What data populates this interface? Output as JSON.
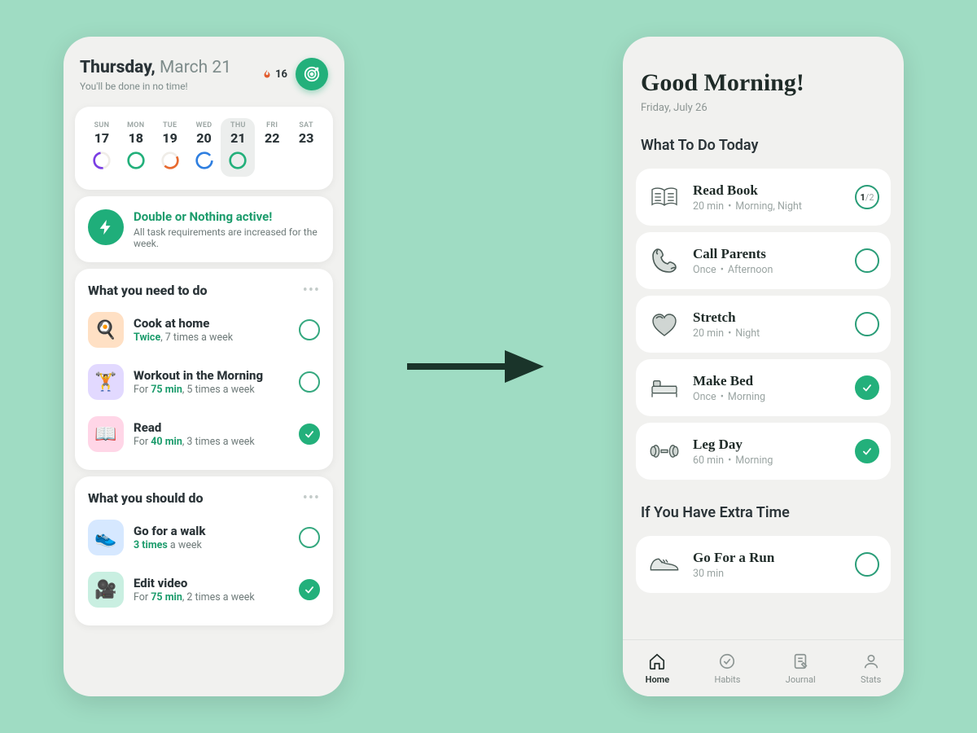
{
  "left": {
    "day_name": "Thursday,",
    "month_day": "March 21",
    "subtitle": "You'll be done in no time!",
    "streak": "16",
    "week": [
      {
        "dow": "SUN",
        "num": "17",
        "ring": "purple-partial"
      },
      {
        "dow": "MON",
        "num": "18",
        "ring": "green-full"
      },
      {
        "dow": "TUE",
        "num": "19",
        "ring": "orange-partial"
      },
      {
        "dow": "WED",
        "num": "20",
        "ring": "blue-open"
      },
      {
        "dow": "THU",
        "num": "21",
        "ring": "green-full",
        "selected": true
      },
      {
        "dow": "FRI",
        "num": "22",
        "ring": "blank"
      },
      {
        "dow": "SAT",
        "num": "23",
        "ring": "blank"
      }
    ],
    "banner": {
      "title": "Double or Nothing active!",
      "sub": "All task requirements are increased for the week."
    },
    "need": {
      "title": "What you need to do",
      "items": [
        {
          "name": "Cook at home",
          "em": "Twice",
          "rest": ", 7 times a week",
          "bg": "#ffe0c4",
          "emoji": "🍳",
          "done": false
        },
        {
          "name": "Workout in the Morning",
          "pre": "For ",
          "em": "75 min",
          "rest": ", 5 times a week",
          "bg": "#e2d9ff",
          "emoji": "🏋️",
          "done": false
        },
        {
          "name": "Read",
          "pre": "For ",
          "em": "40 min",
          "rest": ", 3 times a week",
          "bg": "#ffd6e7",
          "emoji": "📖",
          "done": true
        }
      ]
    },
    "should": {
      "title": "What you should do",
      "items": [
        {
          "name": "Go for a walk",
          "em": "3 times",
          "rest": " a week",
          "bg": "#d6e8ff",
          "emoji": "👟",
          "done": false
        },
        {
          "name": "Edit video",
          "pre": "For ",
          "em": "75 min",
          "rest": ", 2 times a week",
          "bg": "#c9efe1",
          "emoji": "🎥",
          "done": true
        }
      ]
    }
  },
  "right": {
    "greet": "Good Morning!",
    "date": "Friday, July 26",
    "today_title": "What To Do Today",
    "extra_title": "If You Have Extra Time",
    "today": [
      {
        "name": "Read Book",
        "m1": "20 min",
        "m2": "Morning, Night",
        "icon": "book",
        "state": "ratio",
        "n": "1",
        "d": "2"
      },
      {
        "name": "Call Parents",
        "m1": "Once",
        "m2": "Afternoon",
        "icon": "phone",
        "state": "empty"
      },
      {
        "name": "Stretch",
        "m1": "20 min",
        "m2": "Night",
        "icon": "heart",
        "state": "empty"
      },
      {
        "name": "Make Bed",
        "m1": "Once",
        "m2": "Morning",
        "icon": "bed",
        "state": "done"
      },
      {
        "name": "Leg Day",
        "m1": "60 min",
        "m2": "Morning",
        "icon": "dumbbell",
        "state": "done"
      }
    ],
    "extra": [
      {
        "name": "Go For a Run",
        "m1": "30 min",
        "icon": "shoe",
        "state": "empty"
      }
    ],
    "tabs": [
      {
        "label": "Home",
        "icon": "home",
        "active": true
      },
      {
        "label": "Habits",
        "icon": "habits"
      },
      {
        "label": "Journal",
        "icon": "journal"
      },
      {
        "label": "Stats",
        "icon": "stats"
      }
    ]
  }
}
